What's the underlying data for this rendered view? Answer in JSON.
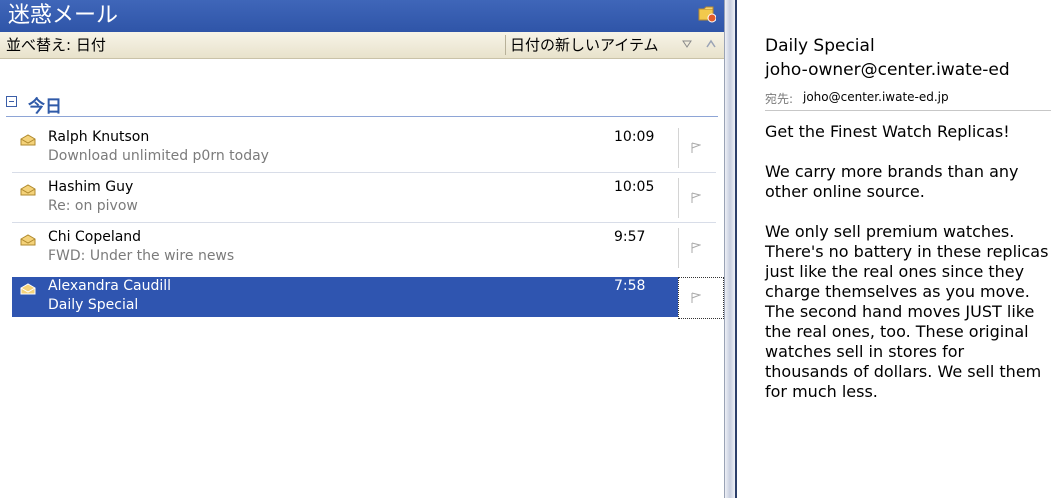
{
  "folder": {
    "title": "迷惑メール"
  },
  "sort": {
    "left_label": "並べ替え: 日付",
    "right_label": "日付の新しいアイテム"
  },
  "group": {
    "label": "今日"
  },
  "messages": [
    {
      "sender": "Ralph Knutson",
      "subject": "Download unlimited p0rn today",
      "time": "10:09",
      "selected": false
    },
    {
      "sender": "Hashim Guy",
      "subject": "Re: on pivow",
      "time": "10:05",
      "selected": false
    },
    {
      "sender": "Chi Copeland",
      "subject": "FWD: Under the wire news",
      "time": "9:57",
      "selected": false
    },
    {
      "sender": "Alexandra Caudill",
      "subject": "Daily Special",
      "time": "7:58",
      "selected": true
    }
  ],
  "reading": {
    "subject": "Daily Special",
    "from": "joho-owner@center.iwate-ed",
    "to_label": "宛先:",
    "to": "joho@center.iwate-ed.jp",
    "body": [
      "Get the Finest Watch Replicas!",
      "We carry more brands than any other online source.",
      "We only sell premium watches. There's no battery in these replicas just like the real ones since they charge themselves as you move. The second hand moves JUST like the real ones, too. These original watches sell in stores for thousands of dollars. We sell them for much less."
    ]
  },
  "colors": {
    "accent": "#2f55b0",
    "folder_bar": "#3f66b9"
  },
  "icons": {
    "folder": "junk-folder-icon",
    "flag": "flag-icon",
    "envelope": "envelope-open-icon"
  }
}
